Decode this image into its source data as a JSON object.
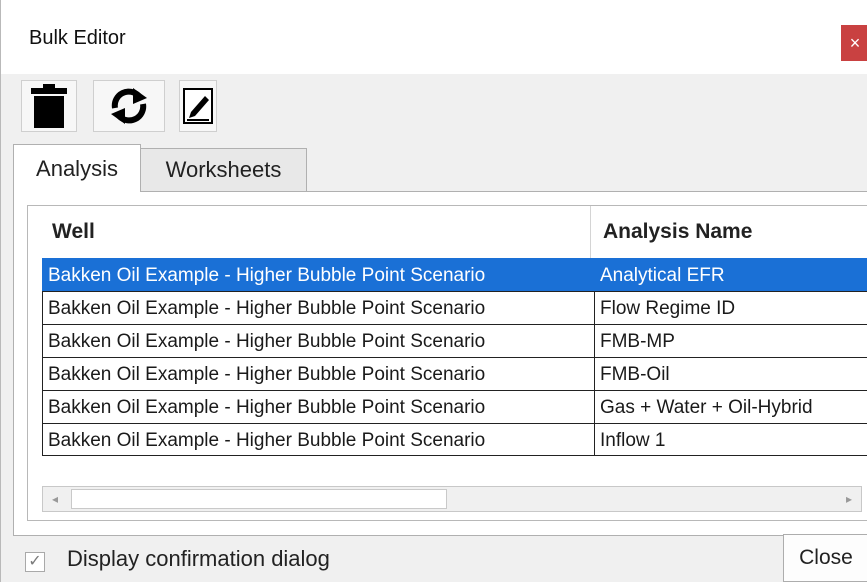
{
  "window": {
    "title": "Bulk Editor",
    "close_glyph": "×"
  },
  "toolbar": {
    "buttons": [
      {
        "icon": "trash-icon"
      },
      {
        "icon": "refresh-icon"
      },
      {
        "icon": "pencil-edit-icon"
      }
    ]
  },
  "tabs": [
    {
      "label": "Analysis",
      "active": true
    },
    {
      "label": "Worksheets",
      "active": false
    }
  ],
  "grid": {
    "columns": [
      "Well",
      "Analysis Name"
    ],
    "rows": [
      {
        "well": "Bakken Oil Example - Higher Bubble Point Scenario",
        "analysis": "Analytical EFR",
        "selected": true
      },
      {
        "well": "Bakken Oil Example - Higher Bubble Point Scenario",
        "analysis": "Flow Regime ID"
      },
      {
        "well": "Bakken Oil Example - Higher Bubble Point Scenario",
        "analysis": "FMB-MP"
      },
      {
        "well": "Bakken Oil Example - Higher Bubble Point Scenario",
        "analysis": "FMB-Oil"
      },
      {
        "well": "Bakken Oil Example - Higher Bubble Point Scenario",
        "analysis": "Gas + Water + Oil-Hybrid"
      },
      {
        "well": "Bakken Oil Example - Higher Bubble Point Scenario",
        "analysis": "Inflow 1"
      }
    ],
    "scroll_left_glyph": "◂",
    "scroll_right_glyph": "▸"
  },
  "footer": {
    "checkbox_label": "Display confirmation dialog",
    "checkbox_checked": true,
    "checkbox_glyph": "✓",
    "close_label": "Close"
  },
  "colors": {
    "selection": "#1a70d6",
    "close_x_bg": "#c94141"
  }
}
